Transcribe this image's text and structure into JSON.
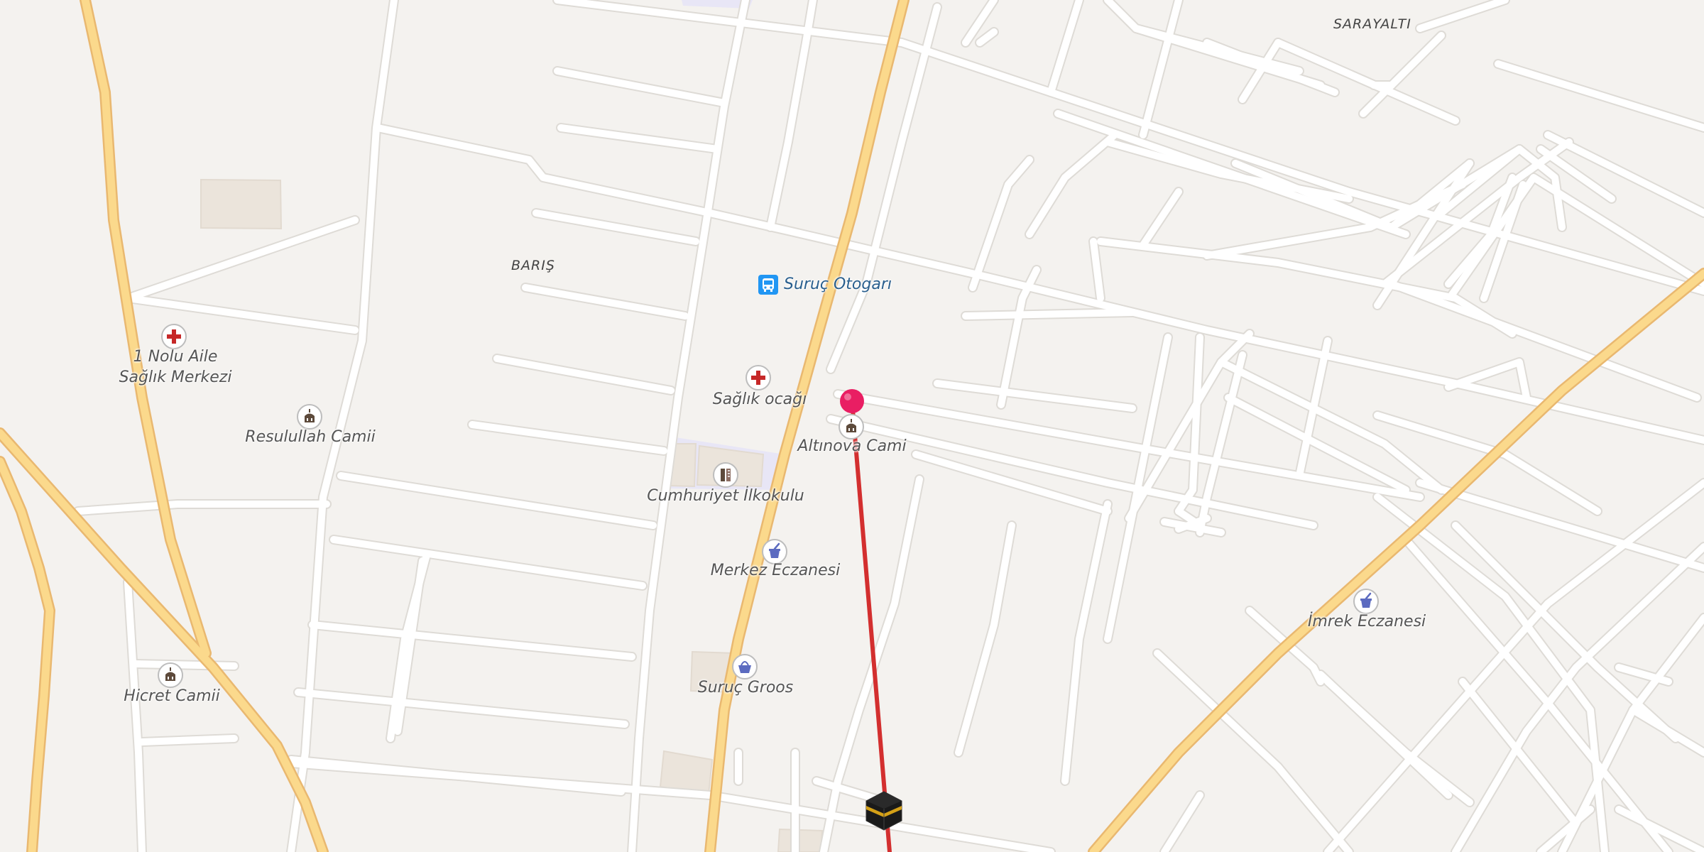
{
  "districts": {
    "sarayalti": "SARAYALTI",
    "baris": "BARIŞ"
  },
  "places": {
    "bus_station": "Suruç Otogarı",
    "saglik_ocagi": "Sağlık ocağı",
    "altinova_cami": "Altınova Cami",
    "cumhuriyet_ilkokulu": "Cumhuriyet İlkokulu",
    "merkez_eczanesi": "Merkez Eczanesi",
    "suruc_groos": "Suruç Groos",
    "imrek_eczanesi": "İmrek Eczanesi",
    "aile_saglik_line1": "1 Nolu Aile",
    "aile_saglik_line2": "Sağlık Merkezi",
    "resulullah_camii": "Resulullah Camii",
    "hicret_camii": "Hicret Camii"
  },
  "icons": {
    "bus": "bus-icon",
    "health": "red-cross-icon",
    "mosque": "mosque-icon",
    "school": "school-icon",
    "pharmacy": "pharmacy-icon",
    "shop": "shopping-basket-icon",
    "pin": "location-pin-icon",
    "qibla": "kaaba-icon"
  },
  "colors": {
    "background": "#f4f2ef",
    "minor_road": "#ffffff",
    "major_road": "#fbd98c",
    "major_road_casing": "#e9b870",
    "building": "#ebe4db",
    "school_area": "#e8e6f6",
    "qibla_line": "#d32f2f",
    "pin": "#e91e63",
    "health": "#c62828",
    "pharmacy": "#5c6bc0",
    "bus": "#2196f3"
  }
}
